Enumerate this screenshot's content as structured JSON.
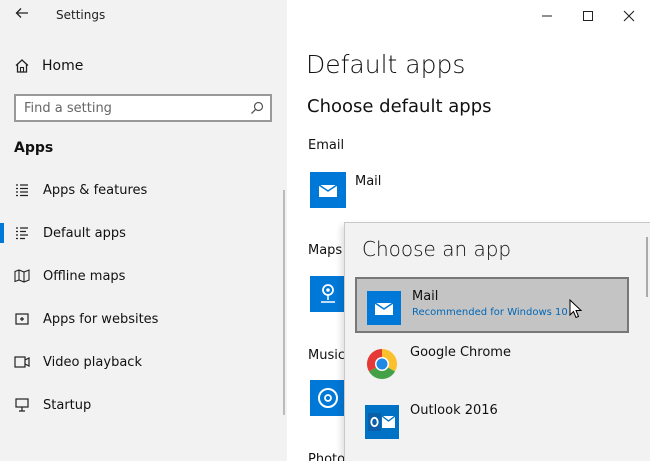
{
  "window": {
    "title": "Settings"
  },
  "sidebar": {
    "home_label": "Home",
    "search_placeholder": "Find a setting",
    "section": "Apps",
    "items": [
      {
        "label": "Apps & features",
        "icon": "list-icon"
      },
      {
        "label": "Default apps",
        "icon": "default-apps-icon",
        "active": true
      },
      {
        "label": "Offline maps",
        "icon": "map-icon"
      },
      {
        "label": "Apps for websites",
        "icon": "link-window-icon"
      },
      {
        "label": "Video playback",
        "icon": "video-icon"
      },
      {
        "label": "Startup",
        "icon": "startup-icon"
      }
    ]
  },
  "main": {
    "title": "Default apps",
    "subtitle": "Choose default apps",
    "categories": [
      {
        "label": "Email",
        "app": "Mail"
      },
      {
        "label": "Maps"
      },
      {
        "label": "Music"
      },
      {
        "label": "Photo"
      }
    ]
  },
  "flyout": {
    "title": "Choose an app",
    "options": [
      {
        "name": "Mail",
        "sub": "Recommended for Windows 10",
        "selected": true
      },
      {
        "name": "Google Chrome"
      },
      {
        "name": "Outlook 2016"
      }
    ]
  },
  "colors": {
    "accent": "#0078d7",
    "sidebar_bg": "#f2f2f2",
    "link": "#0067b8"
  }
}
